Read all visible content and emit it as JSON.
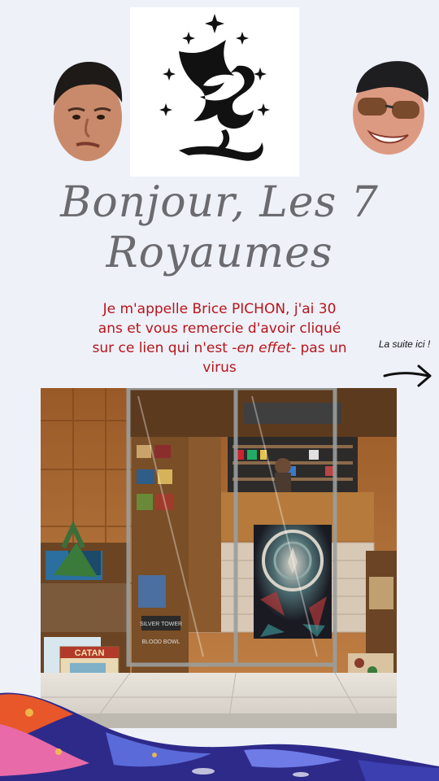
{
  "page": {
    "title_line1": "Bonjour, Les 7",
    "title_line2": "Royaumes",
    "intro_before": "Je m'appelle Brice PICHON, j'ai 30 ans et vous remercie d'avoir cliqué sur ce lien qui n'est -",
    "intro_emphasis": "en effet",
    "intro_after": "- pas un virus",
    "next_label": "La suite ici !"
  },
  "photo": {
    "sign_text_1": "SILVER TOWER",
    "sign_text_2": "BLOOD BOWL",
    "box_text": "CATAN"
  },
  "icons": {
    "logo": "dragon-logo-icon",
    "left_face": "face-sticker-icon",
    "right_face": "face-with-sunglasses-icon",
    "arrow": "arrow-right-icon"
  },
  "colors": {
    "background": "#eef1f8",
    "headline": "#6b6b6f",
    "intro": "#b8141b",
    "wood": "#a86a33"
  }
}
